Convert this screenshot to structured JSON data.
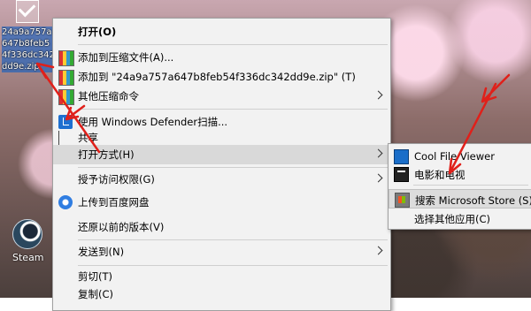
{
  "desktop": {
    "file_name": "24a9a757a647b8feb54f336dc342dd9e.zip",
    "steam_label": "Steam"
  },
  "context_menu": {
    "items": [
      {
        "label": "打开(O)",
        "icon": "",
        "submenu": false
      },
      {
        "label": "添加到压缩文件(A)...",
        "icon": "zip-icon",
        "submenu": false
      },
      {
        "label": "添加到 \"24a9a757a647b8feb54f336dc342dd9e.zip\" (T)",
        "icon": "zip-icon",
        "submenu": false
      },
      {
        "label": "其他压缩命令",
        "icon": "zip-icon",
        "submenu": true
      },
      {
        "label": "使用 Windows Defender扫描...",
        "icon": "defender-icon",
        "submenu": false
      },
      {
        "label": "共享",
        "icon": "share-icon",
        "submenu": false
      },
      {
        "label": "打开方式(H)",
        "icon": "",
        "submenu": true
      },
      {
        "label": "授予访问权限(G)",
        "icon": "",
        "submenu": true
      },
      {
        "label": "上传到百度网盘",
        "icon": "baidu-netdisk-icon",
        "submenu": false
      },
      {
        "label": "还原以前的版本(V)",
        "icon": "",
        "submenu": false
      },
      {
        "label": "发送到(N)",
        "icon": "",
        "submenu": true
      },
      {
        "label": "剪切(T)",
        "icon": "",
        "submenu": false
      },
      {
        "label": "复制(C)",
        "icon": "",
        "submenu": false
      }
    ]
  },
  "open_with_submenu": {
    "items": [
      {
        "label": "Cool File Viewer",
        "icon": "cool-file-viewer-icon"
      },
      {
        "label": "电影和电视",
        "icon": "movies-tv-icon"
      },
      {
        "label": "搜索 Microsoft Store (S)",
        "icon": "microsoft-store-icon"
      },
      {
        "label": "选择其他应用(C)",
        "icon": ""
      }
    ]
  },
  "colors": {
    "menu_bg": "#f2f2f2",
    "highlight": "#d9d9d9",
    "annotation_arrow": "#e0201a"
  }
}
